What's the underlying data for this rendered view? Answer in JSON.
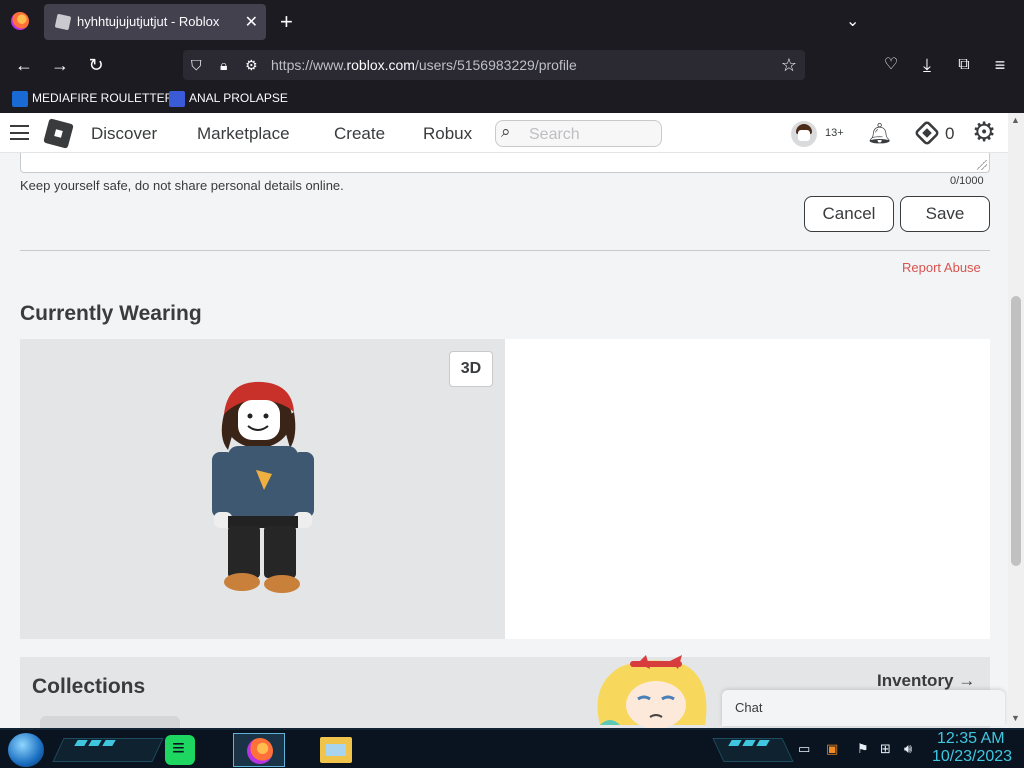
{
  "browser": {
    "tab_title": "hyhhtujujutjutjut - Roblox",
    "tab_close": "✕",
    "new_tab": "+",
    "url_prefix": "https://www.",
    "url_domain": "roblox.com",
    "url_path": "/users/5156983229/profile",
    "bookmarks": [
      {
        "label": "MEDIAFIRE ROULETTER",
        "icon": "mediafire-icon",
        "color": "#1a6ad6"
      },
      {
        "label": "ANAL PROLAPSE",
        "icon": "sigma-icon",
        "color": "#3a5ad6"
      }
    ]
  },
  "roblox_header": {
    "nav": [
      "Discover",
      "Marketplace",
      "Create",
      "Robux"
    ],
    "search_placeholder": "Search",
    "age_badge": "13+",
    "robux_count": "0"
  },
  "profile": {
    "safety_note": "Keep yourself safe, do not share personal details online.",
    "char_count": "0/1000",
    "cancel_label": "Cancel",
    "save_label": "Save",
    "report_label": "Report Abuse",
    "currently_wearing_title": "Currently Wearing",
    "view_3d_label": "3D",
    "collections_title": "Collections",
    "inventory_label": "Inventory →"
  },
  "chat": {
    "label": "Chat"
  },
  "taskbar": {
    "time": "12:35 AM",
    "date": "10/23/2023"
  },
  "colors": {
    "roblox_text": "#393b3d",
    "report_red": "#d9534f",
    "browser_dark": "#1c1b22",
    "taskbar_accent": "#3fc7e0"
  }
}
